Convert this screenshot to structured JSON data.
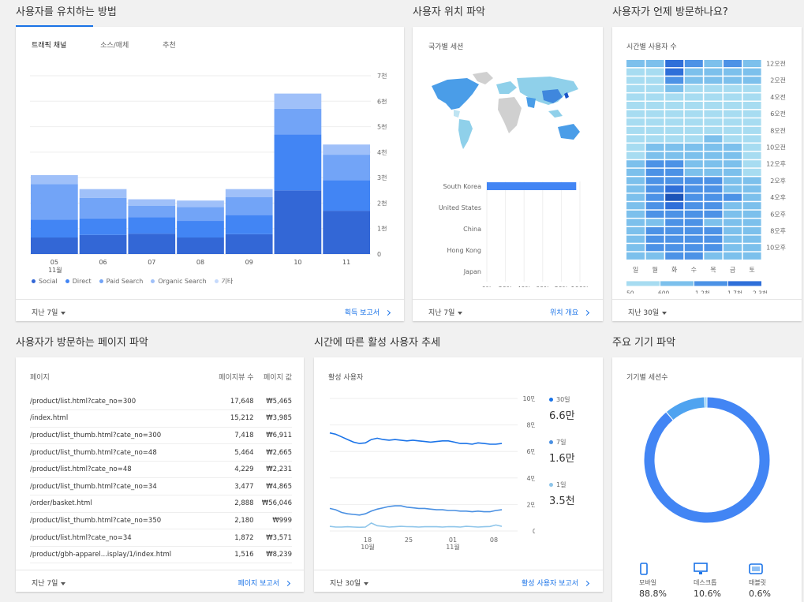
{
  "sections": {
    "acquisition": "사용자를 유치하는 방법",
    "location": "사용자 위치 파악",
    "when": "사용자가 언제 방문하나요?",
    "pages": "사용자가 방문하는 페이지 파악",
    "trend": "시간에 따른 활성 사용자 추세",
    "devices": "주요 기기 파악"
  },
  "acquisition": {
    "tabs": [
      "트래픽 채널",
      "소스/매체",
      "추천"
    ],
    "footer_left": "지난 7일",
    "footer_right": "획득 보고서",
    "legend": [
      {
        "name": "Social",
        "color": "#3367d6"
      },
      {
        "name": "Direct",
        "color": "#4285f4"
      },
      {
        "name": "Paid Search",
        "color": "#72a4f7"
      },
      {
        "name": "Organic Search",
        "color": "#9fc0f9"
      },
      {
        "name": "기타",
        "color": "#c6dafc"
      }
    ],
    "x_month": "11월"
  },
  "location": {
    "subtitle": "국가별 세션",
    "countries": [
      "South Korea",
      "United States",
      "China",
      "Hong Kong",
      "Japan"
    ],
    "footer_left": "지난 7일",
    "footer_right": "위치 개요"
  },
  "when": {
    "subtitle": "시간별 사용자 수",
    "hour_labels": [
      "12오전",
      "2오전",
      "4오전",
      "6오전",
      "8오전",
      "10오전",
      "12오후",
      "2오후",
      "4오후",
      "6오후",
      "8오후",
      "10오후"
    ],
    "day_labels": [
      "일",
      "월",
      "화",
      "수",
      "목",
      "금",
      "토"
    ],
    "scale_labels": [
      "50",
      "600",
      "1.2천",
      "1.7천",
      "2.3천"
    ],
    "footer_left": "지난 30일"
  },
  "pages": {
    "headers": [
      "페이지",
      "페이지뷰 수",
      "페이지 값"
    ],
    "rows": [
      [
        "/product/list.html?cate_no=300",
        "17,648",
        "₩5,465"
      ],
      [
        "/index.html",
        "15,212",
        "₩3,985"
      ],
      [
        "/product/list_thumb.html?cate_no=300",
        "7,418",
        "₩6,911"
      ],
      [
        "/product/list_thumb.html?cate_no=48",
        "5,464",
        "₩2,665"
      ],
      [
        "/product/list.html?cate_no=48",
        "4,229",
        "₩2,231"
      ],
      [
        "/product/list_thumb.html?cate_no=34",
        "3,477",
        "₩4,865"
      ],
      [
        "/order/basket.html",
        "2,888",
        "₩56,046"
      ],
      [
        "/product/list_thumb.html?cate_no=350",
        "2,180",
        "₩999"
      ],
      [
        "/product/list.html?cate_no=34",
        "1,872",
        "₩3,571"
      ],
      [
        "/product/gbh-apparel...isplay/1/index.html",
        "1,516",
        "₩8,239"
      ]
    ],
    "footer_left": "지난 7일",
    "footer_right": "페이지 보고서"
  },
  "trend": {
    "subtitle": "활성 사용자",
    "legend": [
      {
        "label": "30일",
        "value": "6.6만",
        "color": "#1a73e8"
      },
      {
        "label": "7일",
        "value": "1.6만",
        "color": "#4a90e2"
      },
      {
        "label": "1일",
        "value": "3.5천",
        "color": "#8ec5ea"
      }
    ],
    "x_ticks": [
      "18",
      "25",
      "01",
      "08"
    ],
    "x_months": [
      "10월",
      "11월"
    ],
    "footer_left": "지난 30일",
    "footer_right": "활성 사용자 보고서"
  },
  "devices": {
    "subtitle": "기기별 세션수",
    "items": [
      {
        "label": "모바일",
        "value": "88.8%",
        "icon": "mobile-icon"
      },
      {
        "label": "데스크톱",
        "value": "10.6%",
        "icon": "desktop-icon"
      },
      {
        "label": "태블릿",
        "value": "0.6%",
        "icon": "tablet-icon"
      }
    ]
  },
  "chart_data": [
    {
      "type": "bar",
      "stacked": true,
      "categories": [
        "05",
        "06",
        "07",
        "08",
        "09",
        "10",
        "11"
      ],
      "ylim": [
        0,
        7000
      ],
      "y_ticks": [
        "0",
        "1천",
        "2천",
        "3천",
        "4천",
        "5천",
        "6천",
        "7천"
      ],
      "series": [
        {
          "name": "Social",
          "values": [
            650,
            750,
            800,
            650,
            780,
            2500,
            1700
          ]
        },
        {
          "name": "Direct",
          "values": [
            700,
            650,
            650,
            650,
            750,
            2200,
            1200
          ]
        },
        {
          "name": "Paid Search",
          "values": [
            1400,
            800,
            450,
            550,
            700,
            1000,
            1000
          ]
        },
        {
          "name": "Organic Search",
          "values": [
            350,
            350,
            250,
            250,
            320,
            600,
            400
          ]
        },
        {
          "name": "기타",
          "values": [
            0,
            0,
            0,
            0,
            0,
            0,
            0
          ]
        }
      ],
      "colors": [
        "#3367d6",
        "#4285f4",
        "#72a4f7",
        "#9fc0f9",
        "#c6dafc"
      ]
    },
    {
      "type": "bar",
      "orientation": "horizontal",
      "categories": [
        "South Korea",
        "United States",
        "China",
        "Hong Kong",
        "Japan"
      ],
      "values": [
        96,
        0,
        0,
        0,
        0
      ],
      "x_ticks": [
        "0%",
        "20%",
        "40%",
        "60%",
        "80%",
        "100%"
      ],
      "xlim": [
        0,
        100
      ]
    },
    {
      "type": "heatmap",
      "rows": [
        "12오전",
        "1오전",
        "2오전",
        "3오전",
        "4오전",
        "5오전",
        "6오전",
        "7오전",
        "8오전",
        "9오전",
        "10오전",
        "11오전",
        "12오후",
        "1오후",
        "2오후",
        "3오후",
        "4오후",
        "5오후",
        "6오후",
        "7오후",
        "8오후",
        "9오후",
        "10오후",
        "11오후"
      ],
      "columns": [
        "일",
        "월",
        "화",
        "수",
        "목",
        "금",
        "토"
      ],
      "values": [
        [
          600,
          700,
          1800,
          1200,
          900,
          1300,
          1000
        ],
        [
          400,
          500,
          1700,
          900,
          900,
          900,
          800
        ],
        [
          300,
          400,
          1200,
          700,
          600,
          700,
          600
        ],
        [
          200,
          300,
          600,
          400,
          400,
          500,
          400
        ],
        [
          150,
          200,
          400,
          300,
          300,
          300,
          300
        ],
        [
          100,
          200,
          300,
          200,
          200,
          200,
          200
        ],
        [
          100,
          150,
          250,
          200,
          200,
          200,
          150
        ],
        [
          100,
          200,
          300,
          250,
          250,
          200,
          150
        ],
        [
          200,
          300,
          400,
          300,
          300,
          300,
          200
        ],
        [
          300,
          500,
          500,
          400,
          800,
          400,
          300
        ],
        [
          400,
          800,
          900,
          700,
          800,
          600,
          400
        ],
        [
          500,
          1000,
          1100,
          900,
          900,
          800,
          500
        ],
        [
          600,
          1200,
          1300,
          1000,
          1100,
          1000,
          500
        ],
        [
          600,
          1300,
          1400,
          1100,
          1100,
          1000,
          500
        ],
        [
          600,
          1300,
          1500,
          1200,
          1200,
          1100,
          600
        ],
        [
          600,
          1400,
          1700,
          1300,
          1200,
          1100,
          600
        ],
        [
          700,
          1500,
          2300,
          1600,
          1400,
          1200,
          700
        ],
        [
          700,
          1400,
          2000,
          1500,
          1300,
          1100,
          600
        ],
        [
          700,
          1200,
          1500,
          1300,
          1200,
          900,
          600
        ],
        [
          700,
          1100,
          1300,
          1200,
          1100,
          800,
          600
        ],
        [
          800,
          1200,
          1400,
          1300,
          1200,
          900,
          700
        ],
        [
          900,
          1300,
          1500,
          1400,
          1300,
          1000,
          800
        ],
        [
          900,
          1300,
          1400,
          1300,
          1200,
          1000,
          800
        ],
        [
          800,
          1100,
          1300,
          1200,
          1100,
          900,
          700
        ]
      ],
      "scale": [
        50,
        600,
        1200,
        1700,
        2300
      ]
    },
    {
      "type": "line",
      "y_ticks": [
        "0",
        "2만",
        "4만",
        "6만",
        "8만",
        "10만"
      ],
      "ylim": [
        0,
        100000
      ],
      "series": [
        {
          "name": "30일",
          "values": [
            74000,
            73000,
            71000,
            69000,
            67000,
            66000,
            66500,
            69000,
            70000,
            69000,
            68500,
            69000,
            68500,
            68000,
            68500,
            68000,
            67500,
            67000,
            67500,
            68000,
            68000,
            67000,
            66000,
            66000,
            65500,
            66500,
            66000,
            65500,
            65500,
            66000
          ]
        },
        {
          "name": "7일",
          "values": [
            17000,
            16000,
            14000,
            13000,
            12500,
            12000,
            13000,
            15000,
            16500,
            17500,
            18500,
            19000,
            19000,
            18000,
            17500,
            17000,
            17000,
            16500,
            16000,
            16000,
            15500,
            15500,
            15000,
            15000,
            14500,
            15000,
            14500,
            14500,
            15500,
            16000
          ]
        },
        {
          "name": "1일",
          "values": [
            3500,
            3000,
            3000,
            3200,
            3000,
            2800,
            3000,
            6000,
            4000,
            3500,
            3000,
            3200,
            3500,
            3300,
            3200,
            3000,
            3200,
            3300,
            3200,
            3000,
            3300,
            3200,
            3000,
            3500,
            3300,
            3000,
            3200,
            3400,
            4500,
            3500
          ]
        }
      ]
    },
    {
      "type": "pie",
      "donut": true,
      "categories": [
        "모바일",
        "데스크톱",
        "태블릿"
      ],
      "values": [
        88.8,
        10.6,
        0.6
      ],
      "colors": [
        "#4285f4",
        "#4fa3f0",
        "#8fd0f7"
      ]
    }
  ]
}
